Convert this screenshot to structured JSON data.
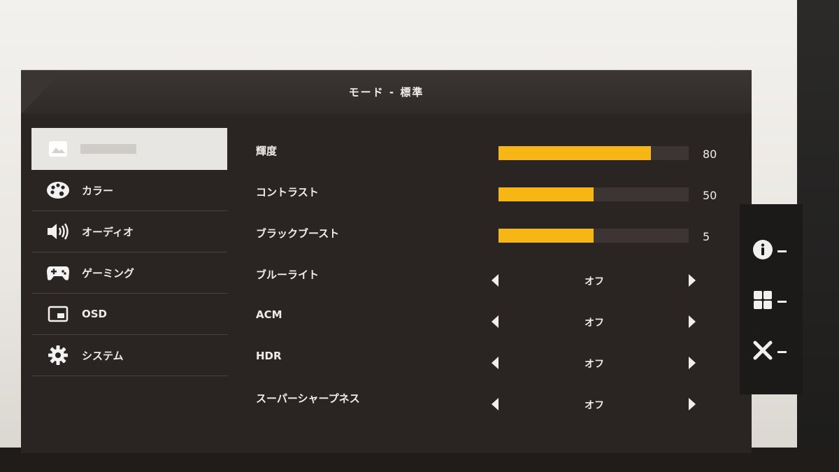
{
  "header": {
    "title": "モード - 標準"
  },
  "sidebar": {
    "items": [
      {
        "label": "",
        "icon": "picture-icon",
        "active": true
      },
      {
        "label": "カラー",
        "icon": "palette-icon"
      },
      {
        "label": "オーディオ",
        "icon": "speaker-icon"
      },
      {
        "label": "ゲーミング",
        "icon": "gamepad-icon"
      },
      {
        "label": "OSD",
        "icon": "osd-window-icon"
      },
      {
        "label": "システム",
        "icon": "gear-icon"
      }
    ]
  },
  "settings": {
    "sliders": [
      {
        "label": "輝度",
        "value": "80",
        "level": 80
      },
      {
        "label": "コントラスト",
        "value": "50",
        "level": 50
      },
      {
        "label": "ブラックブースト",
        "value": "5",
        "level": 50
      }
    ],
    "options": [
      {
        "label": "ブルーライト",
        "value": "オフ"
      },
      {
        "label": "ACM",
        "value": "オフ"
      },
      {
        "label": "HDR",
        "value": "オフ"
      },
      {
        "label": "スーパーシャープネス",
        "value": "オフ"
      }
    ]
  },
  "keys": [
    {
      "icon": "info-icon"
    },
    {
      "icon": "grid-icon"
    },
    {
      "icon": "close-icon"
    }
  ],
  "colors": {
    "accent": "#f6b714",
    "panel": "#2a2523"
  }
}
